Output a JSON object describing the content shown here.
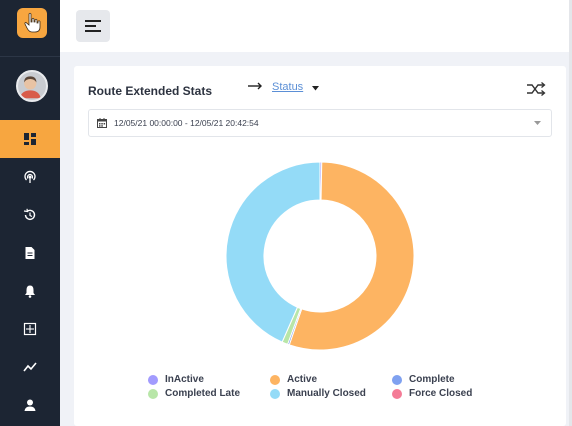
{
  "sidebar": {
    "logo_icon": "hand-pointer-icon",
    "items": [
      {
        "icon": "dashboard-icon",
        "active": true
      },
      {
        "icon": "radar-icon",
        "active": false
      },
      {
        "icon": "history-icon",
        "active": false
      },
      {
        "icon": "document-icon",
        "active": false
      },
      {
        "icon": "bell-icon",
        "active": false
      },
      {
        "icon": "grid-icon",
        "active": false
      },
      {
        "icon": "trend-icon",
        "active": false
      },
      {
        "icon": "user-icon",
        "active": false
      }
    ],
    "accent": "#f7a640",
    "background": "#1c2533"
  },
  "topbar": {
    "menu_icon": "menu-icon"
  },
  "card": {
    "title": "Route Extended Stats",
    "status_link": "Status",
    "date_range": "12/05/21 00:00:00 - 12/05/21 20:42:54"
  },
  "chart_data": {
    "type": "pie",
    "donut": true,
    "series": [
      {
        "name": "InActive",
        "value": 0.3,
        "color": "#a29bfe"
      },
      {
        "name": "Active",
        "value": 55.0,
        "color": "#fdb462"
      },
      {
        "name": "Complete",
        "value": 0.3,
        "color": "#7fa1f0"
      },
      {
        "name": "Completed Late",
        "value": 1.0,
        "color": "#b8e6a8"
      },
      {
        "name": "Manually Closed",
        "value": 43.4,
        "color": "#94dbf7"
      },
      {
        "name": "Force Closed",
        "value": 0,
        "color": "#f47b96"
      }
    ],
    "legend": "bottom"
  }
}
